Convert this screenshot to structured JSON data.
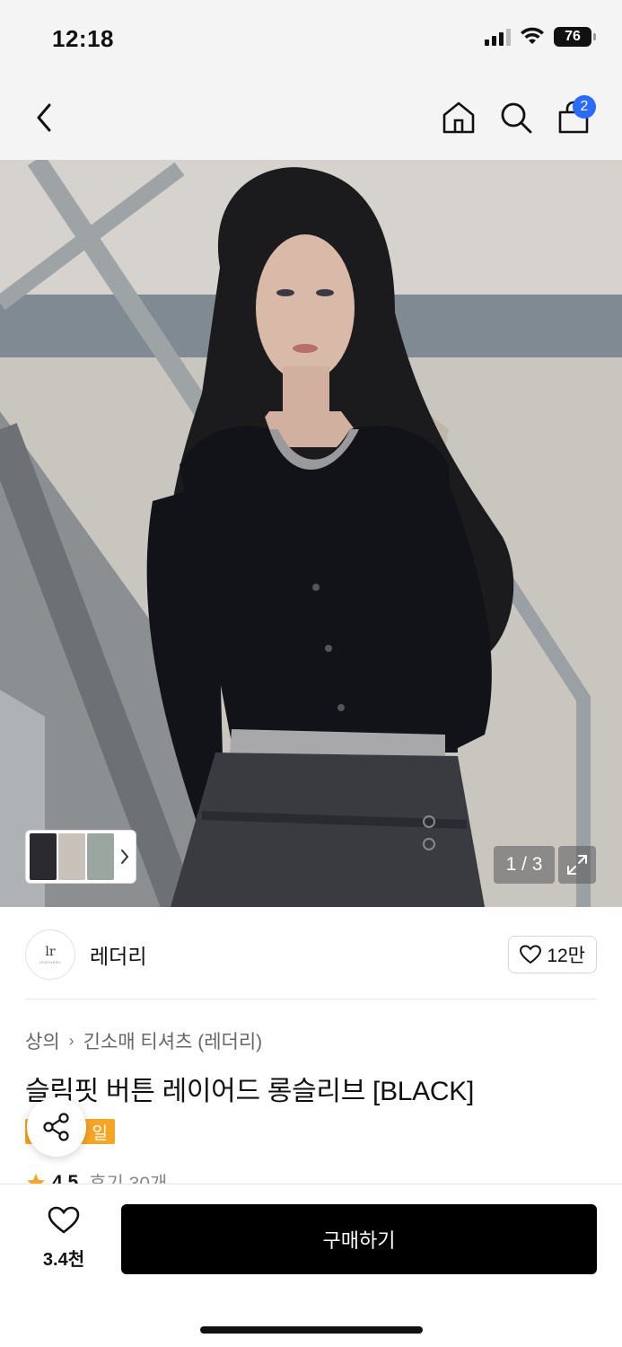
{
  "status_bar": {
    "time": "12:18",
    "battery": "76"
  },
  "nav": {
    "back_icon": "chevron-left-icon",
    "home_icon": "home-icon",
    "search_icon": "search-icon",
    "cart_icon": "shopping-bag-icon",
    "cart_count": "2"
  },
  "gallery": {
    "page_indicator": "1 / 3",
    "expand_icon": "expand-icon"
  },
  "brand": {
    "name": "레더리",
    "logo_mark": "lr",
    "logo_text": "LEATHERY",
    "likes": "12만"
  },
  "breadcrumb": {
    "category": "상의",
    "subcategory": "긴소매 티셔츠 (레더리)"
  },
  "product": {
    "title": "슬림핏 버튼 레이어드 롱슬리브 [BLACK]",
    "badge": "일",
    "rating": "4.5",
    "reviews": "후기 30개"
  },
  "bottom_bar": {
    "wish_count": "3.4천",
    "buy_label": "구매하기"
  },
  "colors": {
    "accent_blue": "#2a6bff",
    "sale_orange": "#f6a623",
    "star": "#f6a623",
    "buy_button": "#000000"
  }
}
